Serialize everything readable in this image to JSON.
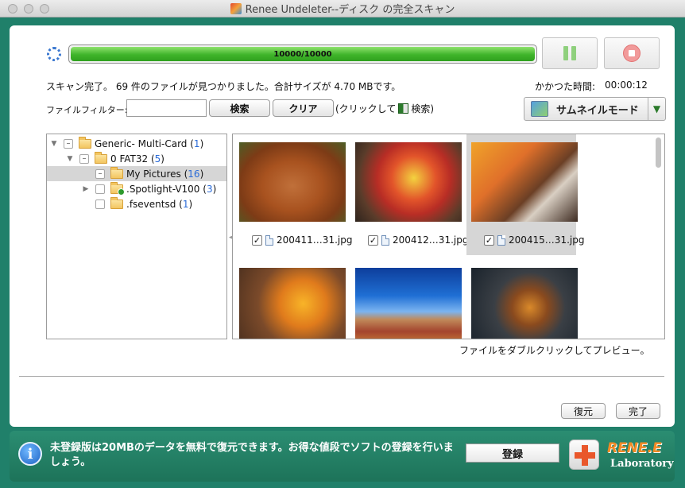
{
  "window": {
    "title": "Renee Undeleter--ディスク の完全スキャン"
  },
  "scan": {
    "progress_text": "10000/10000",
    "progress": 1.0,
    "status": "スキャン完了。 69 件のファイルが見つかりました。合計サイズが 4.70 MBです。",
    "elapsed_label": "かかつた時間:",
    "elapsed_value": "00:00:12"
  },
  "filter": {
    "label": "ファイルフィルター:",
    "value": "",
    "search_label": "検索",
    "clear_label": "クリア",
    "hint_prefix": "(クリックして",
    "hint_suffix": "検索)"
  },
  "view_mode": {
    "selected": "サムネイルモード"
  },
  "tree": {
    "items": [
      {
        "label": "Generic- Multi-Card",
        "count": "1",
        "expander": "▼",
        "check": "–",
        "folder_icon": "folder-open-icon"
      },
      {
        "label": "0 FAT32",
        "count": "5",
        "expander": "▼",
        "check": "–",
        "folder_icon": "folder-open-icon"
      },
      {
        "label": "My Pictures",
        "count": "16",
        "expander": "",
        "check": "–",
        "folder_icon": "folder-icon",
        "selected": true
      },
      {
        "label": ".Spotlight-V100",
        "count": "3",
        "expander": "▶",
        "check": "",
        "folder_icon": "folder-green-icon"
      },
      {
        "label": ".fseventsd",
        "count": "1",
        "expander": "",
        "check": "",
        "folder_icon": "folder-icon"
      }
    ]
  },
  "thumbnails": {
    "items": [
      {
        "name": "200411…31.jpg",
        "checked": true,
        "image": "bench-autumn-photo"
      },
      {
        "name": "200412…31.jpg",
        "checked": true,
        "image": "red-leaf-photo"
      },
      {
        "name": "200415…31.jpg",
        "checked": true,
        "image": "mushroom-leaves-photo",
        "selected": true
      },
      {
        "name": "",
        "checked": false,
        "image": "maple-leaf-photo"
      },
      {
        "name": "",
        "checked": false,
        "image": "blue-sky-landscape-photo"
      },
      {
        "name": "",
        "checked": false,
        "image": "rock-leaves-photo"
      }
    ]
  },
  "hint": {
    "preview": "ファイルをダブルクリックしてプレビュー。"
  },
  "actions": {
    "restore_label": "復元",
    "finish_label": "完了"
  },
  "footer": {
    "message": "未登録版は20MBのデータを無料で復元できます。お得な値段でソフトの登録を行いましょう。",
    "register_label": "登録",
    "logo_name": "RENE.E",
    "logo_sub": "Laboratory"
  }
}
